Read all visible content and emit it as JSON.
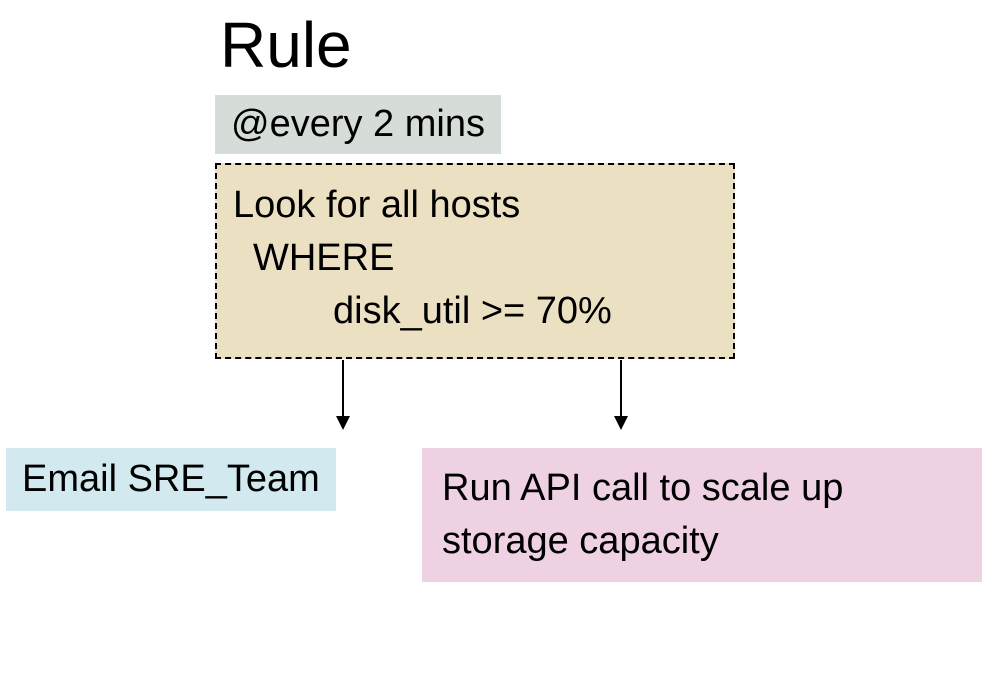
{
  "title": "Rule",
  "schedule": "@every 2 mins",
  "condition": {
    "line1": "Look for all hosts",
    "line2": "WHERE",
    "line3": "disk_util >= 70%"
  },
  "actions": {
    "email": "Email SRE_Team",
    "api": "Run API call to scale up storage capacity"
  }
}
